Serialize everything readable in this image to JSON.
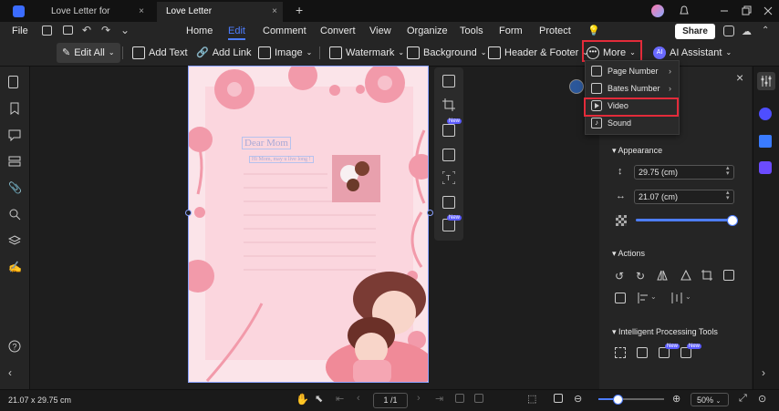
{
  "titlebar": {
    "tabs": [
      {
        "label": "Love Letter for Mother.pdf",
        "close": "×"
      },
      {
        "label": "Love Letter for...her_OCR.pdf *",
        "close": "×"
      }
    ],
    "new_tab": "+"
  },
  "menubar": {
    "file": "File",
    "items": [
      "Home",
      "Edit",
      "Comment",
      "Convert",
      "View",
      "Organize",
      "Tools",
      "Form",
      "Protect"
    ],
    "active": "Edit",
    "share": "Share"
  },
  "toolbar": {
    "edit_all": "Edit All",
    "add_text": "Add Text",
    "add_link": "Add Link",
    "image": "Image",
    "watermark": "Watermark",
    "background": "Background",
    "header_footer": "Header & Footer",
    "more": "More",
    "ai_assistant": "AI Assistant",
    "ai_badge": "AI"
  },
  "dropdown": {
    "items": [
      {
        "label": "Page Number",
        "arrow": "›"
      },
      {
        "label": "Bates Number",
        "arrow": "›"
      },
      {
        "label": "Video",
        "arrow": ""
      },
      {
        "label": "Sound",
        "arrow": ""
      }
    ]
  },
  "page": {
    "heading": "Dear Mom",
    "subline": "Hi Mom, may u live long !"
  },
  "floatbar": {
    "new_label": "New"
  },
  "rightpanel": {
    "close": "×",
    "appearance": "Appearance",
    "height_value": "29.75 (cm)",
    "width_value": "21.07 (cm)",
    "opacity_fraction": 1.0,
    "actions": "Actions",
    "intelligent": "Intelligent Processing Tools",
    "new_label": "New"
  },
  "statusbar": {
    "dimensions": "21.07 x 29.75 cm",
    "page_indicator": "1 /1",
    "zoom": "50%"
  },
  "colors": {
    "accent": "#4d7dff",
    "highlight": "#e32b3a",
    "page_bg": "#fbe4e9"
  }
}
